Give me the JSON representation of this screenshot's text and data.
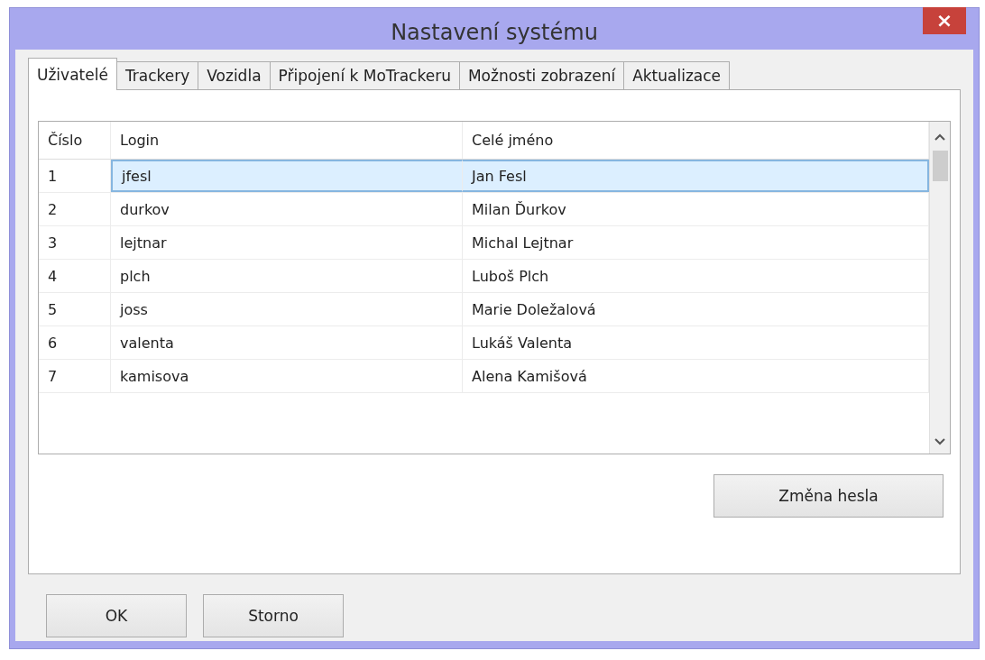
{
  "window": {
    "title": "Nastavení systému",
    "close": "×"
  },
  "tabs": [
    {
      "label": "Uživatelé",
      "selected": true
    },
    {
      "label": "Trackery",
      "selected": false
    },
    {
      "label": "Vozidla",
      "selected": false
    },
    {
      "label": "Připojení k MoTrackeru",
      "selected": false
    },
    {
      "label": "Možnosti zobrazení",
      "selected": false
    },
    {
      "label": "Aktualizace",
      "selected": false
    }
  ],
  "table": {
    "columns": [
      "Číslo",
      "Login",
      "Celé jméno"
    ],
    "rows": [
      {
        "cells": [
          "1",
          "jfesl",
          "Jan Fesl"
        ],
        "selected": true
      },
      {
        "cells": [
          "2",
          "durkov",
          "Milan Ďurkov"
        ],
        "selected": false
      },
      {
        "cells": [
          "3",
          "lejtnar",
          "Michal Lejtnar"
        ],
        "selected": false
      },
      {
        "cells": [
          "4",
          "plch",
          "Luboš Plch"
        ],
        "selected": false
      },
      {
        "cells": [
          "5",
          "joss",
          "Marie Doležalová"
        ],
        "selected": false
      },
      {
        "cells": [
          "6",
          "valenta",
          "Lukáš Valenta"
        ],
        "selected": false
      },
      {
        "cells": [
          "7",
          "kamisova",
          "Alena Kamišová"
        ],
        "selected": false
      }
    ]
  },
  "panel_buttons": [
    "Změna hesla"
  ],
  "dialog_buttons": [
    "OK",
    "Storno"
  ]
}
